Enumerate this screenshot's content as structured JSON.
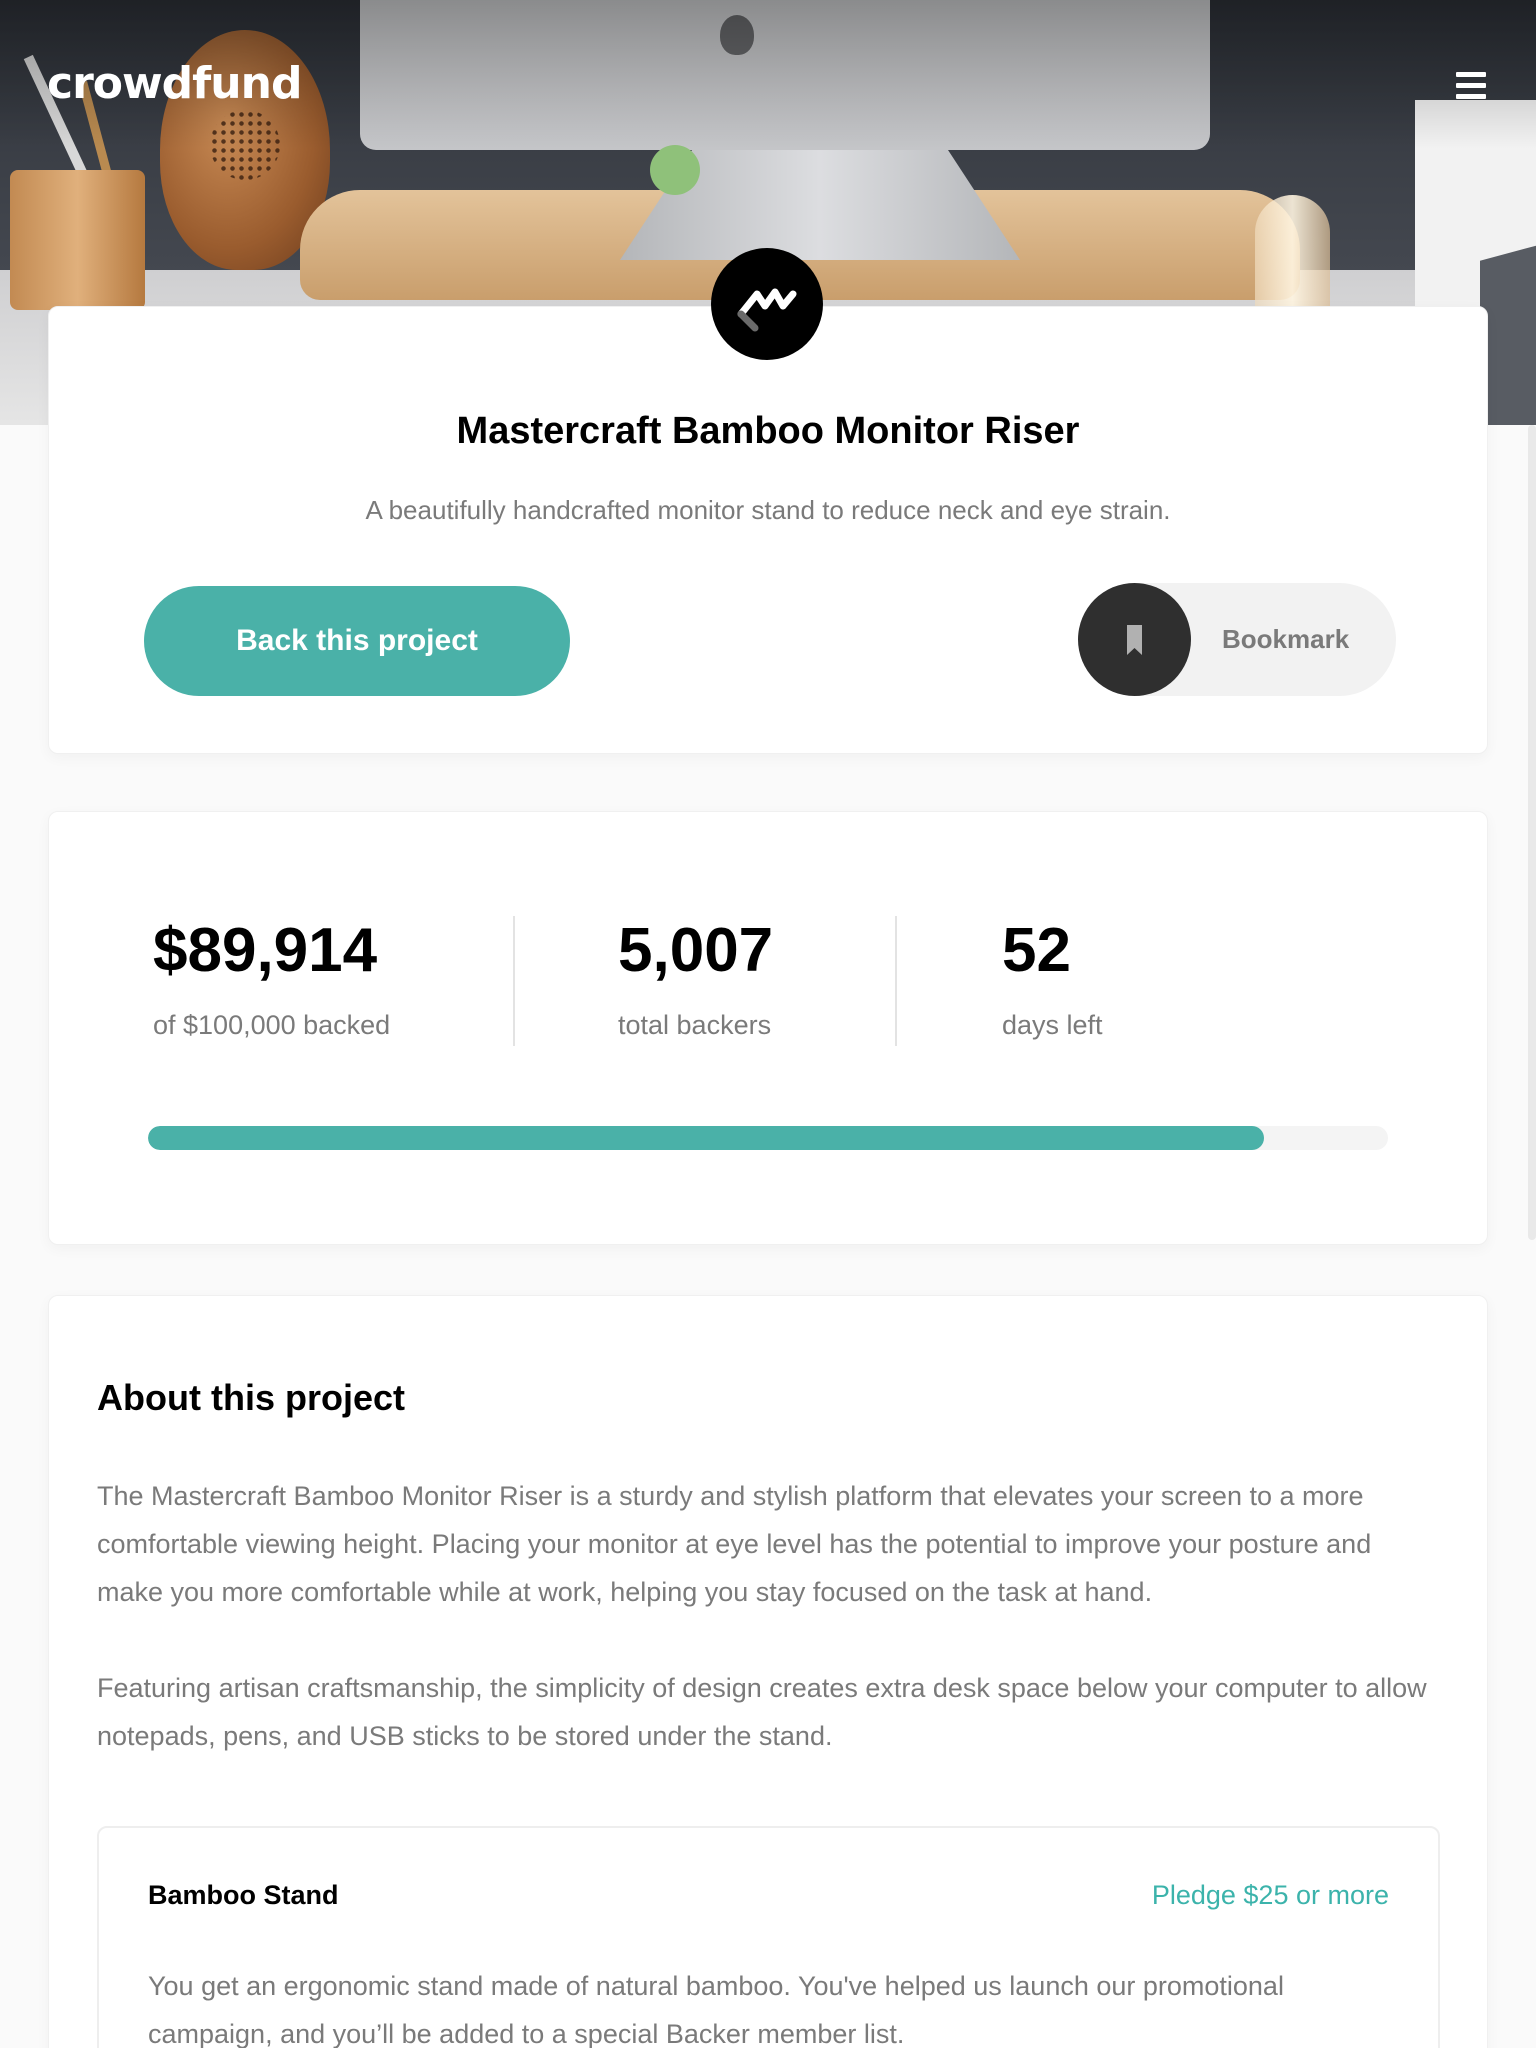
{
  "header": {
    "logo": "crowdfund",
    "menu_icon": "hamburger-menu-icon"
  },
  "project": {
    "logo_icon": "mastercraft-logo-icon",
    "title": "Mastercraft Bamboo Monitor Riser",
    "subtitle": "A beautifully handcrafted monitor stand to reduce neck and eye strain.",
    "back_label": "Back this project",
    "bookmark_label": "Bookmark",
    "bookmark_icon": "bookmark-icon"
  },
  "stats": {
    "backed_amount": "$89,914",
    "backed_label": "of $100,000 backed",
    "backers": "5,007",
    "backers_label": "total backers",
    "days": "52",
    "days_label": "days left",
    "progress_fraction": 0.9
  },
  "about": {
    "heading": "About this project",
    "paragraph1": "The Mastercraft Bamboo Monitor Riser is a sturdy and stylish platform that elevates your screen to a more comfortable viewing height. Placing your monitor at eye level has the potential to improve your posture and make you more comfortable while at work, helping you stay focused on the task at hand.",
    "paragraph2": "Featuring artisan craftsmanship, the simplicity of design creates extra desk space below your computer to allow notepads, pens, and USB sticks to be stored under the stand."
  },
  "rewards": [
    {
      "name": "Bamboo Stand",
      "pledge": "Pledge $25 or more",
      "description": "You get an ergonomic stand made of natural bamboo. You've helped us launch our promotional campaign, and you’ll be added to a special Backer member list."
    }
  ],
  "colors": {
    "accent": "#4ab1a8",
    "accent_text": "#3cb3ab",
    "muted_text": "#7a7a7a",
    "dark": "#2f2f2f"
  }
}
